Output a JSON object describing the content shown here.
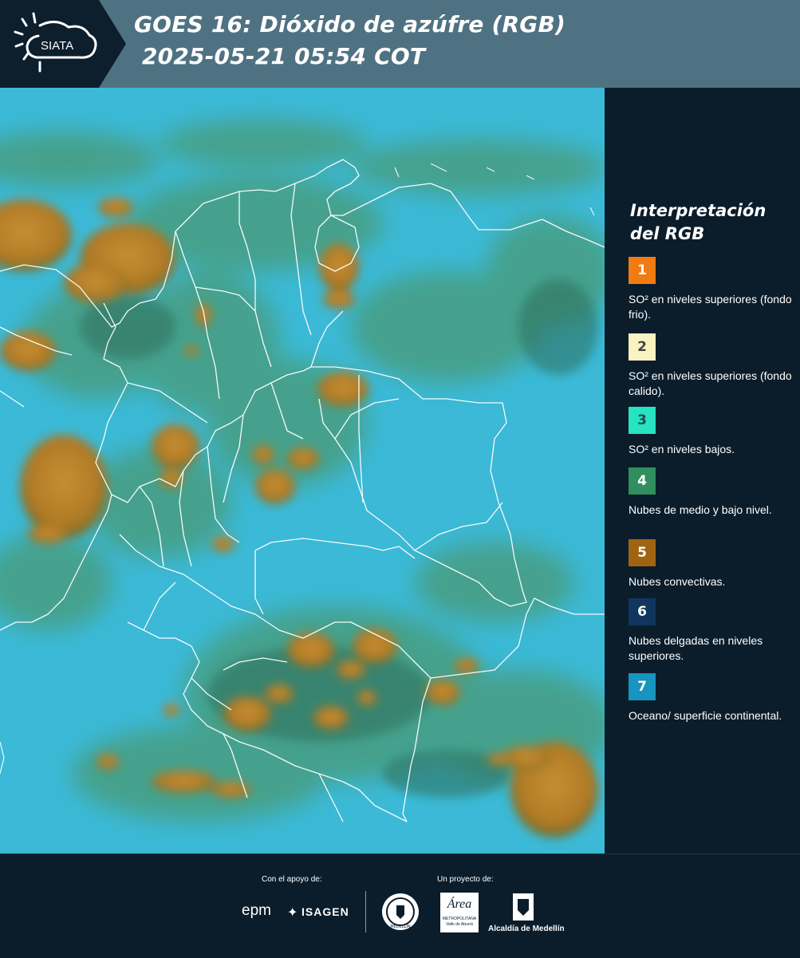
{
  "header": {
    "logo_text": "SIATA",
    "title_line1": "GOES 16: Dióxido de azúfre (RGB)",
    "title_line2": "2025-05-21 05:54 COT"
  },
  "legend": {
    "title": "Interpretación del RGB",
    "items": [
      {
        "number": "1",
        "color": "#f07b12",
        "text_color": "#ffffff",
        "label": "SO² en niveles superiores (fondo frio)."
      },
      {
        "number": "2",
        "color": "#fbf2c2",
        "text_color": "#444444",
        "label": "SO² en niveles superiores (fondo calido)."
      },
      {
        "number": "3",
        "color": "#27e3c1",
        "text_color": "#1c4b4b",
        "label": "SO² en niveles bajos."
      },
      {
        "number": "4",
        "color": "#2f8f5f",
        "text_color": "#ffffff",
        "label": "Nubes de medio y bajo nivel."
      },
      {
        "number": "5",
        "color": "#a06410",
        "text_color": "#ffffff",
        "label": "Nubes convectivas."
      },
      {
        "number": "6",
        "color": "#10365e",
        "text_color": "#ffffff",
        "label": "Nubes delgadas en niveles superiores."
      },
      {
        "number": "7",
        "color": "#1794bf",
        "text_color": "#ffffff",
        "label": "Oceano/ superficie continental."
      }
    ]
  },
  "footer": {
    "support_label": "Con el apoyo de:",
    "project_label": "Un proyecto de:",
    "partner_epm": "epm",
    "partner_isagen": "ISAGEN",
    "partner_area_name": "Área",
    "partner_area_sub": "METROPOLITANA",
    "partner_area_sub2": "Valle de Aburrá",
    "partner_alcaldia": "Alcaldía de Medellín",
    "seal_text": "MEDELLÍN"
  }
}
